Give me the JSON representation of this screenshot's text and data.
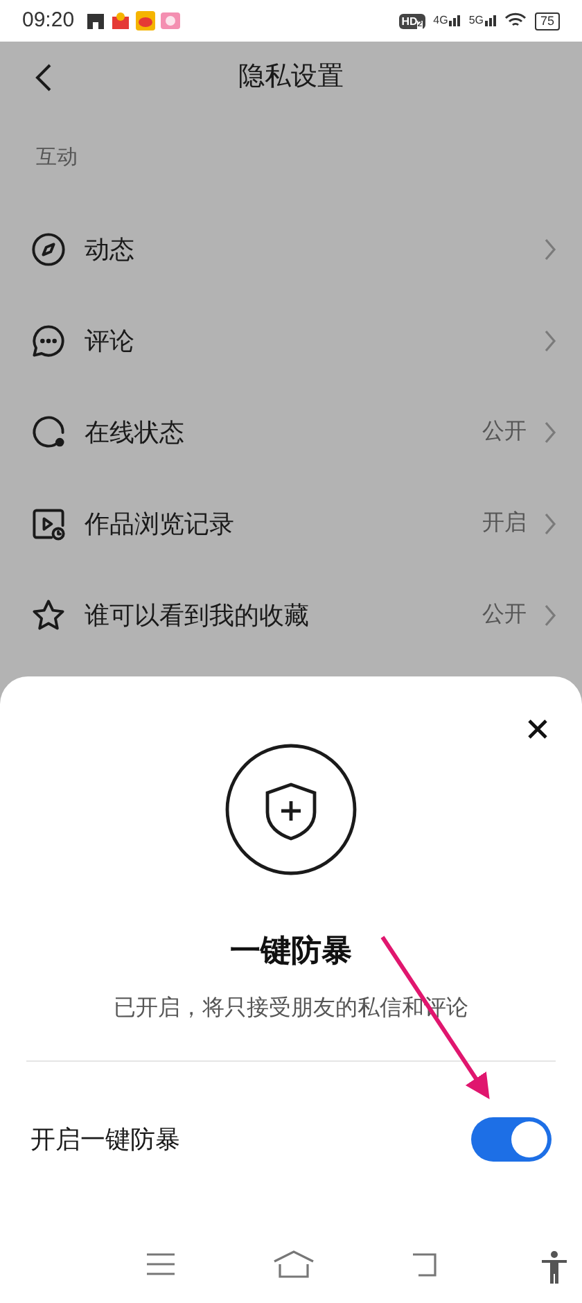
{
  "status_bar": {
    "time": "09:20",
    "hd": "HD",
    "hd_sub": "2",
    "networks": [
      "4G",
      "5G"
    ],
    "battery": "75"
  },
  "header": {
    "title": "隐私设置"
  },
  "section": {
    "title": "互动"
  },
  "items": [
    {
      "kind": "compass",
      "label": "动态"
    },
    {
      "kind": "comment",
      "label": "评论"
    },
    {
      "kind": "status",
      "label": "在线状态",
      "value": "公开"
    },
    {
      "kind": "video",
      "label": "作品浏览记录",
      "value": "开启"
    },
    {
      "kind": "star",
      "label": "谁可以看到我的收藏",
      "value": "公开"
    }
  ],
  "sheet": {
    "title": "一键防暴",
    "subtitle": "已开启，将只接受朋友的私信和评论",
    "toggle": {
      "label": "开启一键防暴",
      "on": true
    }
  }
}
